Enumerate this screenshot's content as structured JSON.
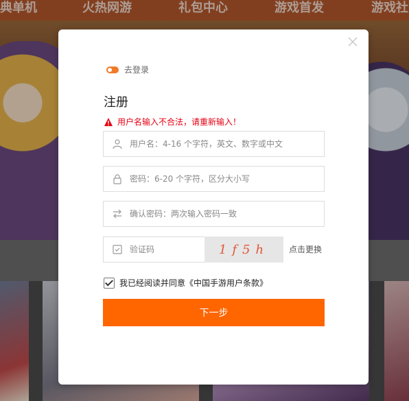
{
  "nav": {
    "items": [
      "典单机",
      "火热网游",
      "礼包中心",
      "游戏首发",
      "游戏社"
    ]
  },
  "modal": {
    "close_label": "×",
    "back_login_label": "去登录",
    "title": "注册",
    "error_message": "用户名输入不合法，请重新输入！",
    "username_placeholder": "用户名：4-16 个字符，英文、数字或中文",
    "password_placeholder": "密码：6-20 个字符，区分大小写",
    "confirm_placeholder": "确认密码：两次输入密码一致",
    "captcha_placeholder": "验证码",
    "captcha_text": "1f5h",
    "refresh_label": "点击更换",
    "agree_label": "我已经阅读并同意《中国手游用户条款》",
    "next_label": "下一步"
  },
  "colors": {
    "accent": "#ff6600",
    "error": "#e60012",
    "toggle": "#f07a2a"
  },
  "icons": {
    "close": "close-icon",
    "toggle": "toggle-icon",
    "warning": "warning-icon",
    "user": "user-icon",
    "lock": "lock-icon",
    "swap": "swap-arrows-icon",
    "captcha": "captcha-check-icon",
    "checkbox": "checkbox-checked-icon"
  }
}
